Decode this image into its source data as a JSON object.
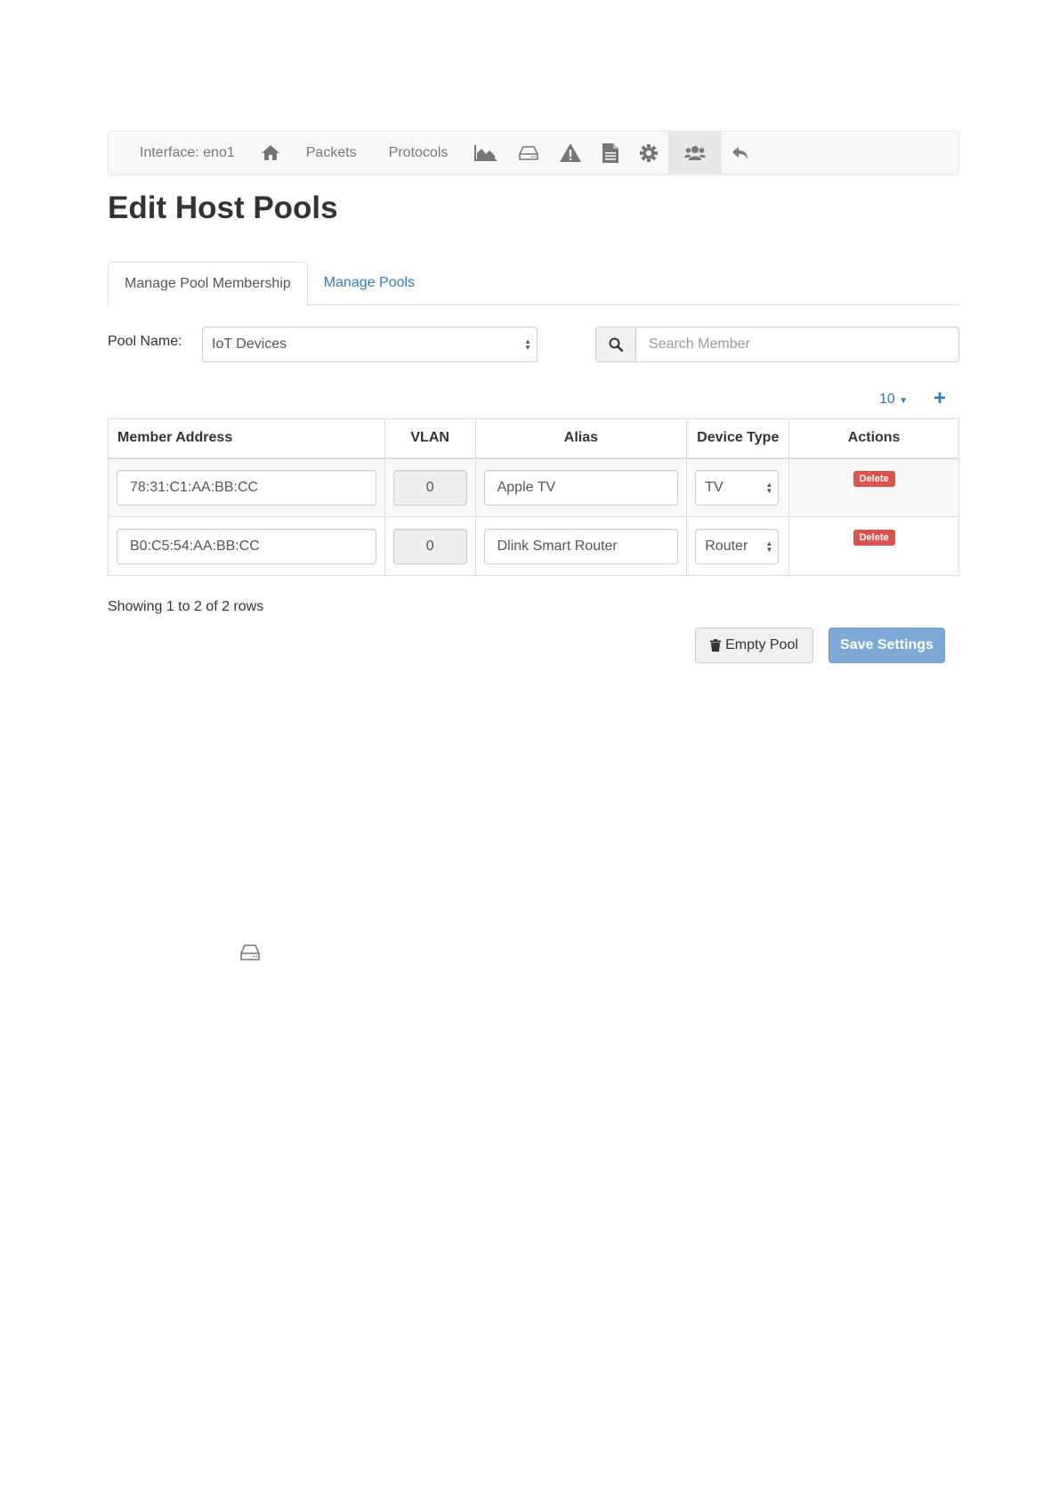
{
  "navbar": {
    "interface_label": "Interface: eno1",
    "packets_label": "Packets",
    "protocols_label": "Protocols",
    "icons": [
      "home-icon",
      "area-chart-icon",
      "hdd-icon",
      "warning-icon",
      "file-icon",
      "gear-icon",
      "users-icon",
      "reply-icon"
    ],
    "active_item": "users-icon"
  },
  "page": {
    "title": "Edit Host Pools"
  },
  "tabs": [
    {
      "label": "Manage Pool Membership",
      "active": true
    },
    {
      "label": "Manage Pools",
      "active": false
    }
  ],
  "pool": {
    "label": "Pool Name:",
    "selected": "IoT Devices"
  },
  "search": {
    "placeholder": "Search Member"
  },
  "pagination": {
    "page_size": "10",
    "add_label": "+"
  },
  "table": {
    "headers": {
      "member_address": "Member Address",
      "vlan": "VLAN",
      "alias": "Alias",
      "device_type": "Device Type",
      "actions": "Actions"
    },
    "rows": [
      {
        "address": "78:31:C1:AA:BB:CC",
        "vlan": "0",
        "alias": "Apple TV",
        "device_type": "TV",
        "action": "Delete"
      },
      {
        "address": "B0:C5:54:AA:BB:CC",
        "vlan": "0",
        "alias": "Dlink Smart Router",
        "device_type": "Router",
        "action": "Delete"
      }
    ]
  },
  "footer": {
    "showing": "Showing 1 to 2 of 2 rows",
    "empty_pool": "Empty Pool",
    "save_settings": "Save Settings"
  },
  "colors": {
    "link": "#337ab7",
    "danger": "#d9534f",
    "save_button": "#7ea9d6",
    "navbar_bg": "#f8f8f8"
  }
}
